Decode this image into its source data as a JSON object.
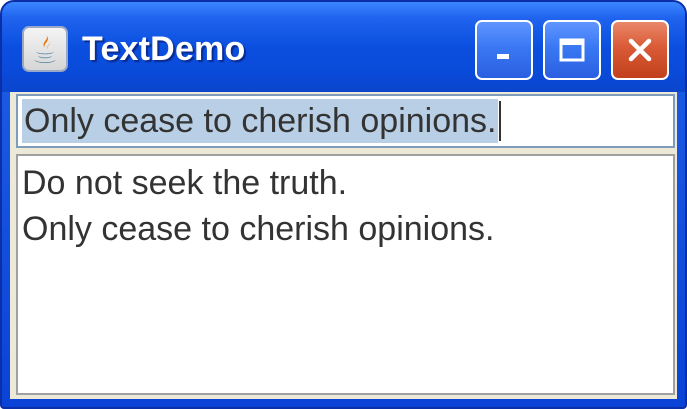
{
  "window": {
    "title": "TextDemo",
    "controls": {
      "minimize": "minimize",
      "maximize": "maximize",
      "close": "close"
    }
  },
  "text_field": {
    "value": "Only cease to cherish opinions."
  },
  "text_area": {
    "lines": [
      "Do not seek the truth.",
      "Only cease to cherish opinions."
    ]
  },
  "colors": {
    "titlebar": "#0b4fe0",
    "close_button": "#d95a36",
    "selection": "#b8cfe5"
  }
}
